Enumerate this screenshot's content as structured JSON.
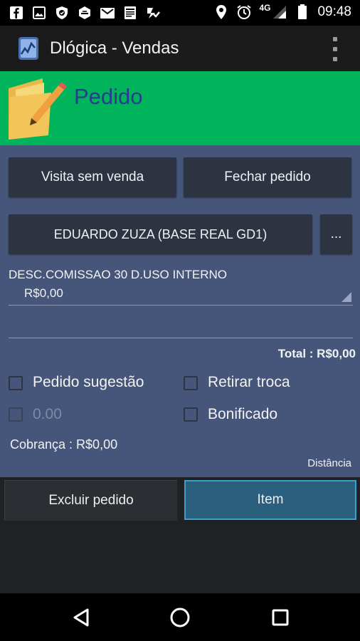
{
  "status_bar": {
    "left_icons": [
      "facebook-icon",
      "image-icon",
      "shield-icon",
      "shield-icon",
      "mail-icon",
      "newspaper-icon",
      "check-icon"
    ],
    "network": "4G",
    "time": "09:48"
  },
  "app_bar": {
    "title": "Dlógica - Vendas"
  },
  "header": {
    "title": "Pedido"
  },
  "actions": {
    "visit_without_sale": "Visita sem venda",
    "close_order": "Fechar pedido"
  },
  "customer": {
    "name": "EDUARDO ZUZA (BASE REAL GD1)",
    "more_label": "..."
  },
  "payment": {
    "label": "DESC.COMISSAO 30 D.USO INTERNO",
    "value": "R$0,00"
  },
  "total_text": "Total : R$0,00",
  "options": {
    "suggestion": "Pedido sugestão",
    "withdraw_exchange": "Retirar troca",
    "amount_placeholder": "0.00",
    "bonus": "Bonificado"
  },
  "billing_text": "Cobrança : R$0,00",
  "distance_label": "Distância",
  "bottom_actions": {
    "delete_order": "Excluir pedido",
    "item": "Item"
  },
  "colors": {
    "header_green": "#00b45c",
    "title_blue": "#2a3c8e",
    "content_bg": "#46567a",
    "button_dark": "#2d3341",
    "accent_item": "#2a5f7e"
  }
}
